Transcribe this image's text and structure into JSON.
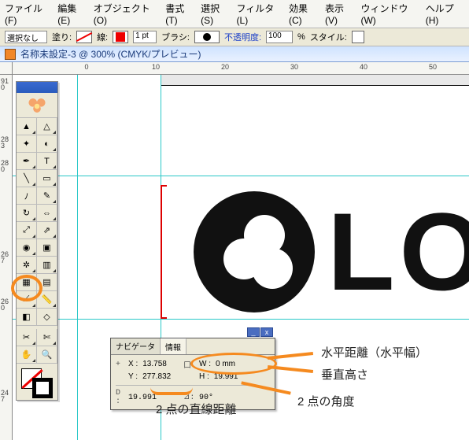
{
  "menu": {
    "file": "ファイル(F)",
    "edit": "編集(E)",
    "object": "オブジェクト(O)",
    "format": "書式(T)",
    "select": "選択(S)",
    "filter": "フィルタ(L)",
    "effect": "効果(C)",
    "view": "表示(V)",
    "window": "ウィンドウ(W)",
    "help": "ヘルプ(H)"
  },
  "ctrl": {
    "selection": "選択なし",
    "fill_label": "塗り:",
    "stroke_label": "線:",
    "pt_value": "1 pt",
    "brush_label": "ブラシ:",
    "opacity_label": "不透明度:",
    "opacity_value": "100",
    "opacity_pct": "%",
    "style_label": "スタイル:"
  },
  "doc": {
    "title": "名称未設定-3 @ 300% (CMYK/プレビュー)"
  },
  "ruler_h": {
    "t0": "0",
    "t1": "10",
    "t2": "20",
    "t3": "30",
    "t4": "40",
    "t5": "50"
  },
  "ruler_v": {
    "t0": "91\n0",
    "t1": "28\n3",
    "t2": "28\n0",
    "t3": "26\n7",
    "t4": "26\n0",
    "t5": "24\n7"
  },
  "logo": {
    "text": "LO"
  },
  "panel": {
    "min": "_",
    "close": "x",
    "tab_nav": "ナビゲータ",
    "tab_info": "情報",
    "icon_xy": "+",
    "lab_x": "X :",
    "val_x": "13.758",
    "lab_y": "Y :",
    "val_y": "277.832",
    "icon_wh": "口",
    "lab_w": "W :",
    "val_w": "0 mm",
    "lab_h": "H :",
    "val_h": "19.991",
    "icon_d": "D :",
    "val_d": "19.991",
    "icon_a": "⊿:",
    "val_a": "90°"
  },
  "annot": {
    "hdist": "水平距離（水平幅）",
    "vdist": "垂直高さ",
    "angle": "2 点の角度",
    "length": "2 点の直線距離"
  }
}
